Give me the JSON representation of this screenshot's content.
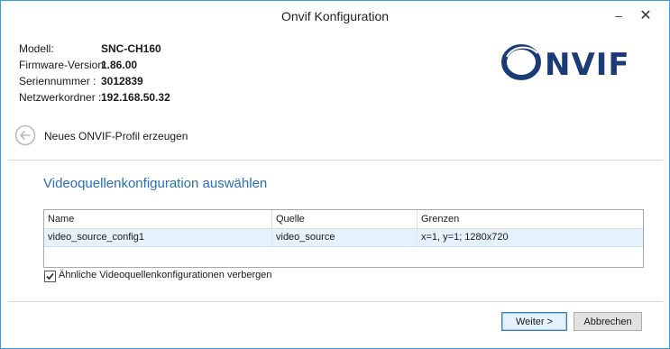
{
  "window": {
    "title": "Onvif Konfiguration",
    "minimize_glyph": "–",
    "close_glyph": "✕"
  },
  "device_info": [
    {
      "label": "Modell:",
      "value": "SNC-CH160"
    },
    {
      "label": "Firmware-Version:",
      "value": "1.86.00"
    },
    {
      "label": "Seriennummer :",
      "value": "3012839"
    },
    {
      "label": "Netzwerkordner :",
      "value": "192.168.50.32"
    }
  ],
  "logo": {
    "text": "ONVIF",
    "color": "#1b3a78"
  },
  "profile": {
    "link_label": "Neues ONVIF-Profil erzeugen",
    "icon": "back-arrow-circle-icon"
  },
  "section": {
    "title": "Videoquellenkonfiguration auswählen",
    "accent": "#2a6fb1"
  },
  "table": {
    "headers": [
      "Name",
      "Quelle",
      "Grenzen"
    ],
    "rows": [
      [
        "video_source_config1",
        "video_source",
        "x=1, y=1; 1280x720"
      ]
    ],
    "selected_row_color": "#e5f1fb"
  },
  "checkbox": {
    "label": "Ähnliche Videoquellenkonfigurationen verbergen",
    "checked": true
  },
  "buttons": {
    "next": "Weiter >",
    "cancel": "Abbrechen"
  }
}
